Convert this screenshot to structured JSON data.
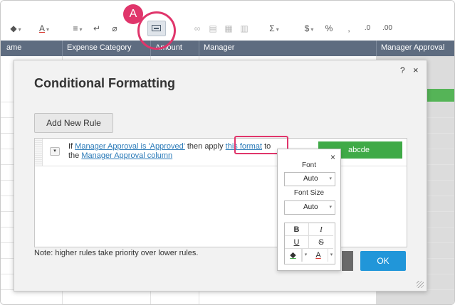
{
  "annotation": {
    "label": "A"
  },
  "toolbar": {
    "fill_color": "◆",
    "text_color": "A",
    "align": "≡",
    "wrap": "↵",
    "clear": "⌀",
    "sum": "Σ",
    "currency": "$",
    "percent": "%",
    "thousands": ",",
    "dec_decrease": ".0",
    "dec_increase": ".00",
    "dropdown": "▾"
  },
  "columns": [
    {
      "label": "ame"
    },
    {
      "label": "Expense Category"
    },
    {
      "label": "Amount"
    },
    {
      "label": "Manager"
    },
    {
      "label": "Manager Approval"
    }
  ],
  "dialog": {
    "title": "Conditional Formatting",
    "help": "?",
    "close": "×",
    "add_rule": "Add New Rule",
    "rule": {
      "prefix": "If ",
      "condition": "Manager Approval is 'Approved'",
      "middle": " then apply ",
      "format_link": "this format",
      "suffix": " to the ",
      "target": "Manager Approval column",
      "preview": "abcde"
    },
    "note": "Note: higher rules take priority over lower rules.",
    "ok": "OK"
  },
  "format_popup": {
    "close": "×",
    "font_label": "Font",
    "font_value": "Auto",
    "size_label": "Font Size",
    "size_value": "Auto",
    "bold": "B",
    "italic": "I",
    "underline": "U",
    "strike": "S",
    "fill": "◆",
    "text_color": "A"
  },
  "colors": {
    "header": "#5e6c80",
    "accent": "#e0356b",
    "ok": "#2196d9",
    "green": "#3faa47"
  }
}
